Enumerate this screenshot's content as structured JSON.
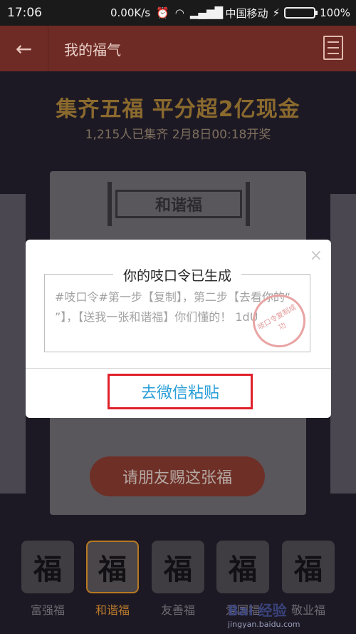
{
  "status_bar": {
    "time": "17:06",
    "speed": "0.00K/s",
    "carrier": "中国移动",
    "battery": "100%"
  },
  "header": {
    "back_icon": "←",
    "title": "我的福气"
  },
  "campaign": {
    "headline": "集齐五福 平分超2亿现金",
    "subline": "1,215人已集齐 2月8日00:18开奖"
  },
  "card": {
    "name": "和谐福",
    "give_button": "请朋友赐这张福"
  },
  "fu_cards": [
    {
      "glyph": "福",
      "label": "富强福"
    },
    {
      "glyph": "福",
      "label": "和谐福"
    },
    {
      "glyph": "福",
      "label": "友善福"
    },
    {
      "glyph": "福",
      "label": "爱国福"
    },
    {
      "glyph": "福",
      "label": "敬业福"
    }
  ],
  "dialog": {
    "close_icon": "×",
    "title": "你的吱口令已生成",
    "message": "#吱口令#第一步【复制】，第二步【去看你的“            ”】，【送我一张和谐福】你们懂的！        1dU",
    "stamp_text": "吱口令复制成功",
    "paste_button": "去微信粘贴"
  },
  "watermark": {
    "text": "Bai 经验",
    "url": "jingyan.baidu.com"
  }
}
